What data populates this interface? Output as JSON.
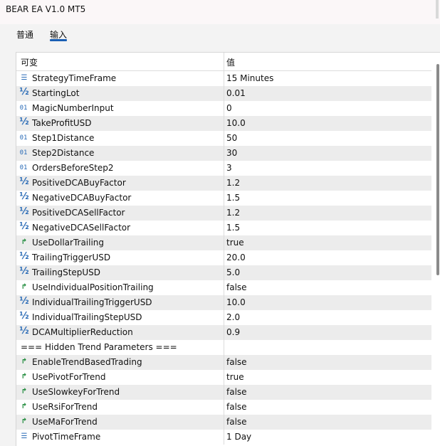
{
  "window": {
    "title": "BEAR EA V1.0 MT5"
  },
  "tabs": [
    {
      "label": "普通",
      "active": false
    },
    {
      "label": "输入",
      "active": true
    }
  ],
  "table": {
    "columns": [
      "可变",
      "值"
    ],
    "rows": [
      {
        "icon": "list-icon",
        "name": "StrategyTimeFrame",
        "value": "15 Minutes"
      },
      {
        "icon": "half-icon",
        "name": "StartingLot",
        "value": "0.01"
      },
      {
        "icon": "integer-icon",
        "name": "MagicNumberInput",
        "value": "0"
      },
      {
        "icon": "half-icon",
        "name": "TakeProfitUSD",
        "value": "10.0"
      },
      {
        "icon": "integer-icon",
        "name": "Step1Distance",
        "value": "50"
      },
      {
        "icon": "integer-icon",
        "name": "Step2Distance",
        "value": "30"
      },
      {
        "icon": "integer-icon",
        "name": "OrdersBeforeStep2",
        "value": "3"
      },
      {
        "icon": "half-icon",
        "name": "PositiveDCABuyFactor",
        "value": "1.2"
      },
      {
        "icon": "half-icon",
        "name": "NegativeDCABuyFactor",
        "value": "1.5"
      },
      {
        "icon": "half-icon",
        "name": "PositiveDCASellFactor",
        "value": "1.2"
      },
      {
        "icon": "half-icon",
        "name": "NegativeDCASellFactor",
        "value": "1.5"
      },
      {
        "icon": "bool-icon",
        "name": "UseDollarTrailing",
        "value": "true"
      },
      {
        "icon": "half-icon",
        "name": "TrailingTriggerUSD",
        "value": "20.0"
      },
      {
        "icon": "half-icon",
        "name": "TrailingStepUSD",
        "value": "5.0"
      },
      {
        "icon": "bool-icon",
        "name": "UseIndividualPositionTrailing",
        "value": "false"
      },
      {
        "icon": "half-icon",
        "name": "IndividualTrailingTriggerUSD",
        "value": "10.0"
      },
      {
        "icon": "half-icon",
        "name": "IndividualTrailingStepUSD",
        "value": "2.0"
      },
      {
        "icon": "half-icon",
        "name": "DCAMultiplierReduction",
        "value": "0.9"
      },
      {
        "icon": "",
        "name": "=== Hidden Trend Parameters ===",
        "value": ""
      },
      {
        "icon": "bool-icon",
        "name": "EnableTrendBasedTrading",
        "value": "false"
      },
      {
        "icon": "bool-icon",
        "name": "UsePivotForTrend",
        "value": "true"
      },
      {
        "icon": "bool-icon",
        "name": "UseSlowkeyForTrend",
        "value": "false"
      },
      {
        "icon": "bool-icon",
        "name": "UseRsiForTrend",
        "value": "false"
      },
      {
        "icon": "bool-icon",
        "name": "UseMaForTrend",
        "value": "false"
      },
      {
        "icon": "list-icon",
        "name": "PivotTimeFrame",
        "value": "1 Day"
      }
    ]
  },
  "icons": {
    "list-icon": "☰",
    "half-icon": "½",
    "integer-icon": "01",
    "bool-icon": "↱"
  },
  "colors": {
    "icon_blue": "#2a6bb6",
    "icon_green": "#1e8a3a",
    "tab_underline": "#1a5fb4",
    "alt_row": "#ececec"
  }
}
